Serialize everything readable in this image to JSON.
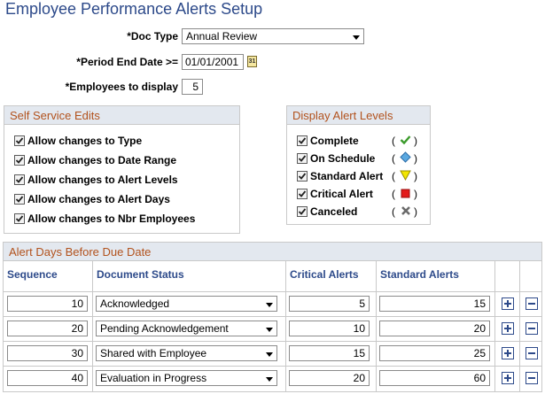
{
  "page_title": "Employee Performance Alerts Setup",
  "form": {
    "doc_type": {
      "label": "*Doc Type",
      "value": "Annual Review"
    },
    "period_end_date": {
      "label": "*Period End Date >=",
      "value": "01/01/2001",
      "calendar_glyph": "31"
    },
    "employees_to_display": {
      "label": "*Employees to display",
      "value": "5"
    }
  },
  "self_service_edits": {
    "title": "Self Service Edits",
    "items": [
      {
        "label": "Allow changes to Type",
        "checked": true
      },
      {
        "label": "Allow changes to Date Range",
        "checked": true
      },
      {
        "label": "Allow changes to Alert Levels",
        "checked": true
      },
      {
        "label": "Allow changes to Alert Days",
        "checked": true
      },
      {
        "label": "Allow changes to Nbr Employees",
        "checked": true
      }
    ]
  },
  "display_alert_levels": {
    "title": "Display Alert Levels",
    "items": [
      {
        "label": "Complete",
        "checked": true,
        "icon": "green-check-icon",
        "color": "#3a9a2a",
        "open": "(",
        "close": ")"
      },
      {
        "label": "On Schedule",
        "checked": true,
        "icon": "blue-diamond-icon",
        "color": "#5aa8e0",
        "open": "(",
        "close": ")"
      },
      {
        "label": "Standard Alert",
        "checked": true,
        "icon": "yellow-triangle-icon",
        "color": "#f2e600",
        "open": "(",
        "close": ")"
      },
      {
        "label": "Critical Alert",
        "checked": true,
        "icon": "red-square-icon",
        "color": "#e31b1b",
        "open": "(",
        "close": ")"
      },
      {
        "label": "Canceled",
        "checked": true,
        "icon": "gray-x-icon",
        "color": "#6a6a6a",
        "open": "(",
        "close": ")"
      }
    ]
  },
  "alert_days": {
    "title": "Alert Days Before Due Date",
    "columns": [
      "Sequence",
      "Document Status",
      "Critical Alerts",
      "Standard Alerts"
    ],
    "rows": [
      {
        "sequence": "10",
        "status": "Acknowledged",
        "critical": "5",
        "standard": "15"
      },
      {
        "sequence": "20",
        "status": "Pending Acknowledgement",
        "critical": "10",
        "standard": "20"
      },
      {
        "sequence": "30",
        "status": "Shared with Employee",
        "critical": "15",
        "standard": "25"
      },
      {
        "sequence": "40",
        "status": "Evaluation in Progress",
        "critical": "20",
        "standard": "60"
      }
    ]
  },
  "colors": {
    "title": "#2d4a8a",
    "section_header_text": "#b2521d",
    "section_header_bg": "#e3e8ef",
    "border": "#c9c9c9"
  }
}
